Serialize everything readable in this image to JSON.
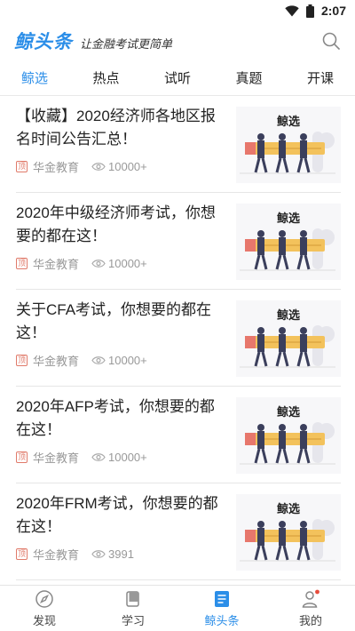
{
  "status": {
    "time": "2:07"
  },
  "header": {
    "logo": "鲸头条",
    "slogan": "让金融考试更简单"
  },
  "tabs": [
    {
      "label": "鲸选",
      "active": true
    },
    {
      "label": "热点",
      "active": false
    },
    {
      "label": "试听",
      "active": false
    },
    {
      "label": "真题",
      "active": false
    },
    {
      "label": "开课",
      "active": false
    }
  ],
  "articles": [
    {
      "title": "【收藏】2020经济师各地区报名时间公告汇总！",
      "badge": "顶",
      "source": "华金教育",
      "views": "10000+",
      "thumb_label": "鲸选"
    },
    {
      "title": "2020年中级经济师考试，你想要的都在这！",
      "badge": "顶",
      "source": "华金教育",
      "views": "10000+",
      "thumb_label": "鲸选"
    },
    {
      "title": "关于CFA考试，你想要的都在这！",
      "badge": "顶",
      "source": "华金教育",
      "views": "10000+",
      "thumb_label": "鲸选"
    },
    {
      "title": "2020年AFP考试，你想要的都在这！",
      "badge": "顶",
      "source": "华金教育",
      "views": "10000+",
      "thumb_label": "鲸选"
    },
    {
      "title": "2020年FRM考试，你想要的都在这！",
      "badge": "顶",
      "source": "华金教育",
      "views": "3991",
      "thumb_label": "鲸选"
    }
  ],
  "bottom_nav": [
    {
      "label": "发现",
      "icon": "compass-icon",
      "active": false
    },
    {
      "label": "学习",
      "icon": "book-icon",
      "active": false
    },
    {
      "label": "鲸头条",
      "icon": "news-icon",
      "active": true
    },
    {
      "label": "我的",
      "icon": "user-icon",
      "active": false
    }
  ],
  "colors": {
    "accent": "#2b8ee8",
    "badge": "#e07a6a"
  }
}
